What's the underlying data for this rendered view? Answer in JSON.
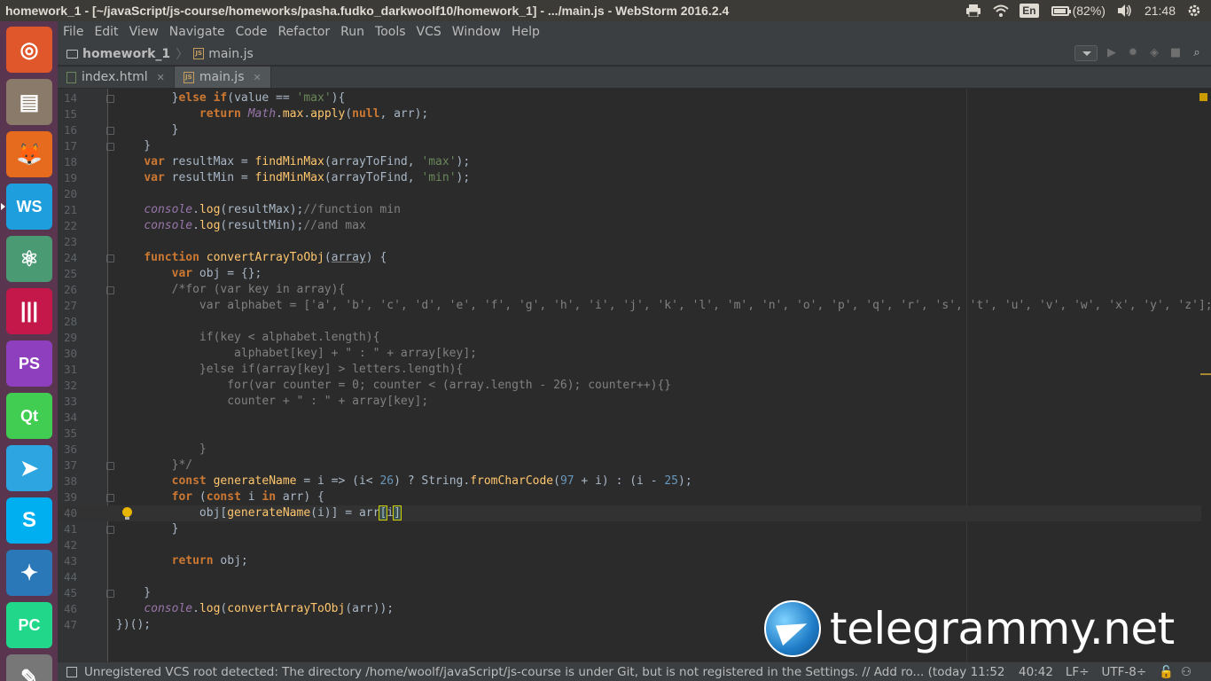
{
  "window": {
    "title": "homework_1 - [~/javaScript/js-course/homeworks/pasha.fudko_darkwoolf10/homework_1] - .../main.js - WebStorm 2016.2.4"
  },
  "tray": {
    "keyboard_layout": "En",
    "battery_percent": "(82%)",
    "battery_level": 0.82,
    "clock": "21:48"
  },
  "launcher": {
    "items": [
      {
        "name": "ubuntu-dash",
        "color": "#e0572b",
        "glyph": "◎"
      },
      {
        "name": "files",
        "color": "#8a7a6a",
        "glyph": "▤"
      },
      {
        "name": "firefox",
        "color": "#e66b1f",
        "glyph": "🦊"
      },
      {
        "name": "webstorm",
        "color": "#1e9edc",
        "glyph": "WS"
      },
      {
        "name": "atom",
        "color": "#4a9a73",
        "glyph": "⚛"
      },
      {
        "name": "unknown-app",
        "color": "#c4184a",
        "glyph": "|||"
      },
      {
        "name": "phpstorm",
        "color": "#8e3fbd",
        "glyph": "PS"
      },
      {
        "name": "qt-creator",
        "color": "#41cd52",
        "glyph": "Qt"
      },
      {
        "name": "telegram",
        "color": "#2ca5e0",
        "glyph": "➤"
      },
      {
        "name": "skype",
        "color": "#00aff0",
        "glyph": "S"
      },
      {
        "name": "app-blue",
        "color": "#2a78b8",
        "glyph": "✦"
      },
      {
        "name": "pycharm",
        "color": "#21d789",
        "glyph": "PC"
      },
      {
        "name": "text-editor",
        "color": "#777777",
        "glyph": "✎"
      }
    ]
  },
  "menu": {
    "items": [
      "File",
      "Edit",
      "View",
      "Navigate",
      "Code",
      "Refactor",
      "Run",
      "Tools",
      "VCS",
      "Window",
      "Help"
    ]
  },
  "breadcrumb": {
    "project": "homework_1",
    "file": "main.js"
  },
  "tabs": [
    {
      "label": "index.html",
      "active": false
    },
    {
      "label": "main.js",
      "active": true
    }
  ],
  "editor": {
    "lines": [
      {
        "n": "14",
        "html": "        }<span class=\"kw\">else if</span>(value == <span class=\"str\">'max'</span>){",
        "fold": true
      },
      {
        "n": "15",
        "html": "            <span class=\"kw\">return</span> <span class=\"glob\">Math</span>.<span class=\"fn\">max</span>.<span class=\"fn\">apply</span>(<span class=\"kw\">null</span>, arr);"
      },
      {
        "n": "16",
        "html": "        }",
        "fold": true
      },
      {
        "n": "17",
        "html": "    }",
        "fold": true
      },
      {
        "n": "18",
        "html": "    <span class=\"kw\">var</span> resultMax = <span class=\"fn\">findMinMax</span>(arrayToFind, <span class=\"str\">'max'</span>);"
      },
      {
        "n": "19",
        "html": "    <span class=\"kw\">var</span> resultMin = <span class=\"fn\">findMinMax</span>(arrayToFind, <span class=\"str\">'min'</span>);"
      },
      {
        "n": "20",
        "html": ""
      },
      {
        "n": "21",
        "html": "    <span class=\"glob\">console</span>.<span class=\"fn\">log</span>(resultMax);<span class=\"cmt\">//function min</span>"
      },
      {
        "n": "22",
        "html": "    <span class=\"glob\">console</span>.<span class=\"fn\">log</span>(resultMin);<span class=\"cmt\">//and max</span>"
      },
      {
        "n": "23",
        "html": ""
      },
      {
        "n": "24",
        "html": "    <span class=\"kw\">function</span> <span class=\"fn\">convertArrayToObj</span>(<span class=\"param\">array</span>) {",
        "fold": true
      },
      {
        "n": "25",
        "html": "        <span class=\"kw\">var</span> obj = {};"
      },
      {
        "n": "26",
        "html": "        <span class=\"cmt\">/*for (var key in array){</span>",
        "fold": true
      },
      {
        "n": "27",
        "html": "<span class=\"cmt\">            var alphabet = ['a', 'b', 'c', 'd', 'e', 'f', 'g', 'h', 'i', 'j', 'k', 'l', 'm', 'n', 'o', 'p', 'q', 'r', 's', 't', 'u', 'v', 'w', 'x', 'y', 'z'];</span>"
      },
      {
        "n": "28",
        "html": ""
      },
      {
        "n": "29",
        "html": "<span class=\"cmt\">            if(key &lt; alphabet.length){</span>"
      },
      {
        "n": "30",
        "html": "<span class=\"cmt\">                 alphabet[key] + \" : \" + array[key];</span>"
      },
      {
        "n": "31",
        "html": "<span class=\"cmt\">            }else if(array[key] &gt; letters.length){</span>"
      },
      {
        "n": "32",
        "html": "<span class=\"cmt\">                for(var counter = 0; counter &lt; (array.length - 26); counter++){}</span>"
      },
      {
        "n": "33",
        "html": "<span class=\"cmt\">                counter + \" : \" + array[key];</span>"
      },
      {
        "n": "34",
        "html": ""
      },
      {
        "n": "35",
        "html": ""
      },
      {
        "n": "36",
        "html": "<span class=\"cmt\">            }</span>"
      },
      {
        "n": "37",
        "html": "<span class=\"cmt\">        }*/</span>",
        "fold": true
      },
      {
        "n": "38",
        "html": "        <span class=\"kw\">const</span> <span class=\"fn\">generateName</span> = i =&gt; (i&lt; <span class=\"num\">26</span>) ? <span class=\"glob\" style=\"font-style:normal;color:#a9b7c6\">String</span>.<span class=\"fn\">fromCharCode</span>(<span class=\"num\">97</span> + i) : (i - <span class=\"num\">25</span>);"
      },
      {
        "n": "39",
        "html": "        <span class=\"kw\">for</span> (<span class=\"kw\">const</span> i <span class=\"kw\">in</span> arr) {",
        "fold": true
      },
      {
        "n": "40",
        "html": "            obj[<span class=\"fn\">generateName</span>(i)] = arr<span class=\"mark\">[</span>i<span class=\"mark\">]</span>",
        "current": true,
        "bulb": true
      },
      {
        "n": "41",
        "html": "        }",
        "fold": true
      },
      {
        "n": "42",
        "html": ""
      },
      {
        "n": "43",
        "html": "        <span class=\"kw\">return</span> obj;"
      },
      {
        "n": "44",
        "html": ""
      },
      {
        "n": "45",
        "html": "    }",
        "fold": true
      },
      {
        "n": "46",
        "html": "    <span class=\"glob\">console</span>.<span class=\"fn\">log</span>(<span class=\"fn\">convertArrayToObj</span>(arr));"
      },
      {
        "n": "47",
        "html": "})();"
      }
    ]
  },
  "status": {
    "message": "Unregistered VCS root detected: The directory /home/woolf/javaScript/js-course is under Git, but is not registered in the Settings. // Add ro... (today 11:52)",
    "position": "40:42",
    "line_sep": "LF÷",
    "encoding": "UTF-8÷"
  },
  "watermark": {
    "text": "telegrammy.net"
  }
}
